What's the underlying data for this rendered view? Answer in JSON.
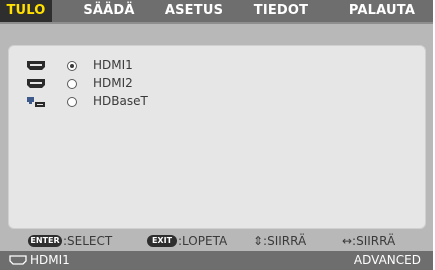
{
  "tabs": [
    {
      "label": "TULO",
      "active": true
    },
    {
      "label": "SÄÄDÄ",
      "active": false
    },
    {
      "label": "ASETUS",
      "active": false
    },
    {
      "label": "TIEDOT",
      "active": false
    },
    {
      "label": "PALAUTA",
      "active": false
    }
  ],
  "inputs": [
    {
      "label": "HDMI1",
      "selected": true,
      "icon": "hdmi-port-icon"
    },
    {
      "label": "HDMI2",
      "selected": false,
      "icon": "hdmi-port-icon"
    },
    {
      "label": "HDBaseT",
      "selected": false,
      "icon": "hdbaset-network-icon"
    }
  ],
  "help": {
    "enter_key": "ENTER",
    "enter_text": ":SELECT",
    "exit_key": "EXIT",
    "exit_text": ":LOPETA",
    "updown_text": "⇕:SIIRRÄ",
    "leftright_text": "↔:SIIRRÄ"
  },
  "status": {
    "source_icon": "hdmi-port-icon",
    "source_label": "HDMI1",
    "mode_label": "ADVANCED"
  },
  "colors": {
    "tab_active_text": "#ffe000",
    "tab_bar": "#6e6e6e",
    "background": "#b8b8b8",
    "panel": "#e6e6e6"
  }
}
